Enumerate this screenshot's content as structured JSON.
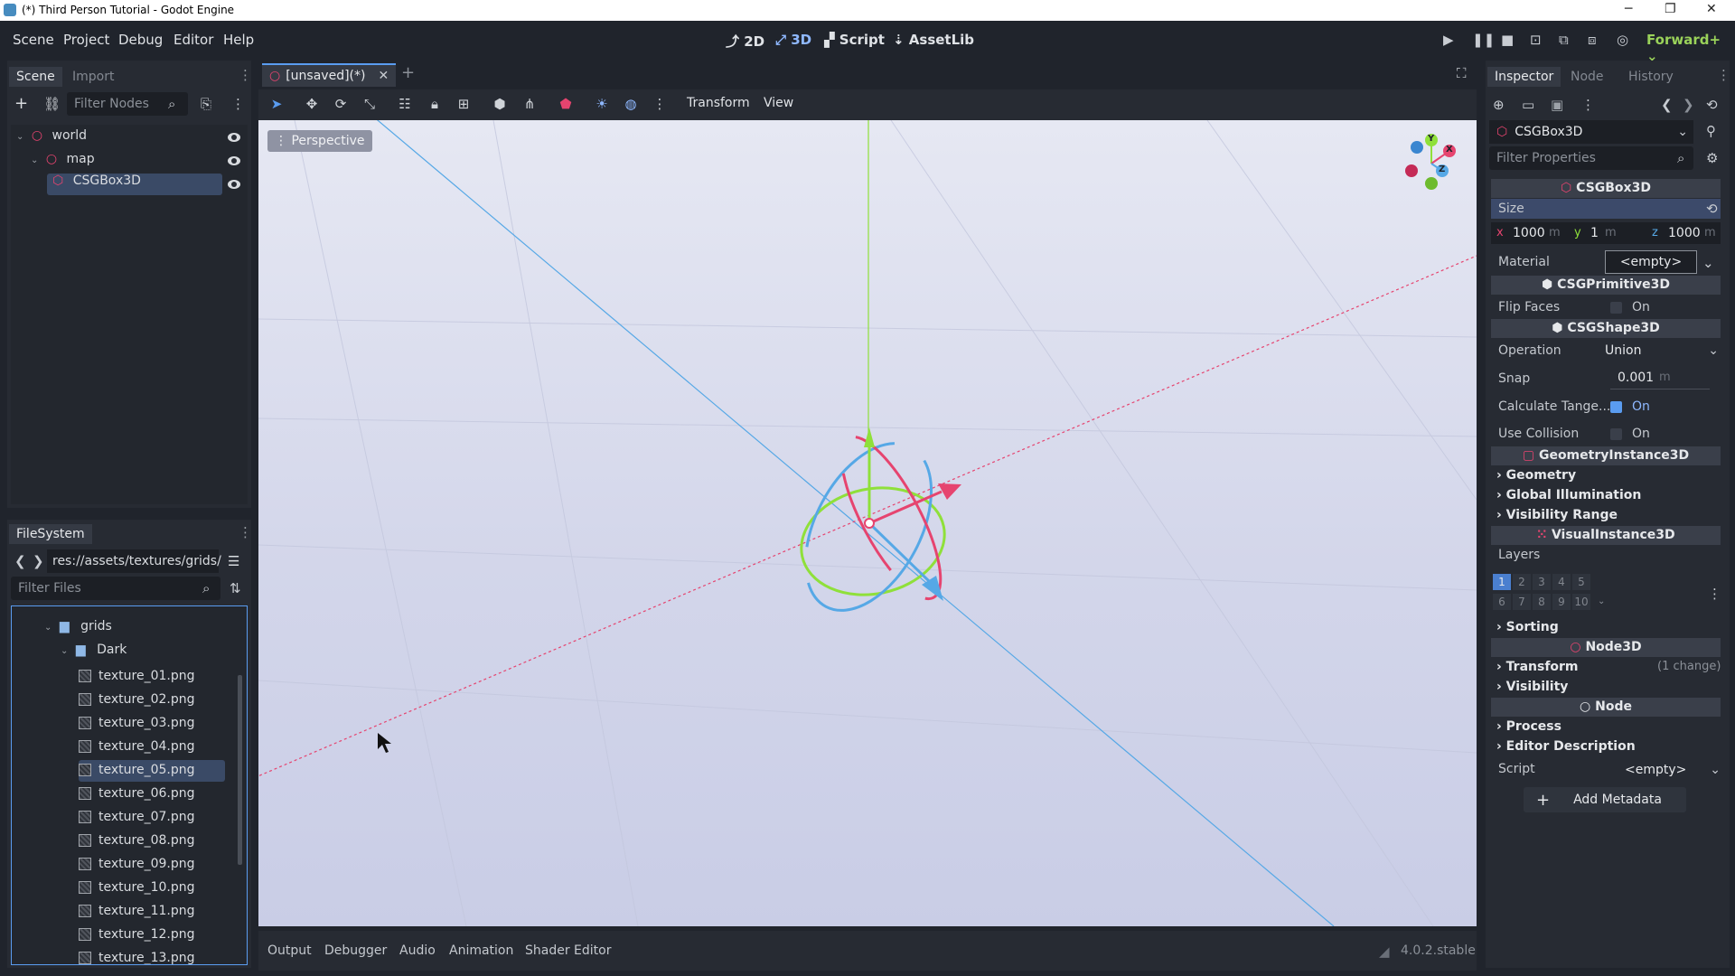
{
  "window": {
    "title": "(*) Third Person Tutorial - Godot Engine",
    "controls": [
      "─",
      "❐",
      "✕"
    ]
  },
  "menubar": {
    "menus": [
      "Scene",
      "Project",
      "Debug",
      "Editor",
      "Help"
    ],
    "workspaces": [
      "2D",
      "3D",
      "Script",
      "AssetLib"
    ],
    "active_workspace": "3D",
    "renderer": "Forward+"
  },
  "scene_dock": {
    "tabs": [
      "Scene",
      "Import"
    ],
    "filter_placeholder": "Filter Nodes",
    "nodes": [
      "world",
      "map",
      "CSGBox3D"
    ],
    "selected": "CSGBox3D"
  },
  "filesystem": {
    "tab": "FileSystem",
    "path": "res://assets/textures/grids/",
    "filter_placeholder": "Filter Files",
    "folders": [
      "grids",
      "Dark"
    ],
    "files": [
      "texture_01.png",
      "texture_02.png",
      "texture_03.png",
      "texture_04.png",
      "texture_05.png",
      "texture_06.png",
      "texture_07.png",
      "texture_08.png",
      "texture_09.png",
      "texture_10.png",
      "texture_11.png",
      "texture_12.png",
      "texture_13.png"
    ],
    "selected_file": "texture_05.png"
  },
  "editor": {
    "tab_label": "[unsaved](*)",
    "menus": [
      "Transform",
      "View"
    ],
    "perspective_label": "Perspective",
    "gizmo_axes": [
      "Y",
      "X",
      "Z"
    ]
  },
  "bottom_panel": {
    "tabs": [
      "Output",
      "Debugger",
      "Audio",
      "Animation",
      "Shader Editor"
    ],
    "version": "4.0.2.stable"
  },
  "inspector": {
    "tabs": [
      "Inspector",
      "Node",
      "History"
    ],
    "object_name": "CSGBox3D",
    "filter_placeholder": "Filter Properties",
    "sections": {
      "csgbox": "CSGBox3D",
      "csgprimitive": "CSGPrimitive3D",
      "csgshape": "CSGShape3D",
      "geometry_instance": "GeometryInstance3D",
      "visual_instance": "VisualInstance3D",
      "node3d": "Node3D",
      "node": "Node"
    },
    "size": {
      "label": "Size",
      "x_label": "x",
      "x": "1000",
      "y_label": "y",
      "y": "1",
      "z_label": "z",
      "z": "1000",
      "unit": "m"
    },
    "material": {
      "label": "Material",
      "value": "<empty>"
    },
    "flip_faces": {
      "label": "Flip Faces",
      "value": "On",
      "checked": false
    },
    "operation": {
      "label": "Operation",
      "value": "Union"
    },
    "snap": {
      "label": "Snap",
      "value": "0.001",
      "unit": "m"
    },
    "calculate_tangents": {
      "label": "Calculate Tange...",
      "value": "On",
      "checked": true
    },
    "use_collision": {
      "label": "Use Collision",
      "value": "On",
      "checked": false
    },
    "geometry_groups": [
      "Geometry",
      "Global Illumination",
      "Visibility Range"
    ],
    "layers": {
      "label": "Layers",
      "row1": [
        "1",
        "2",
        "3",
        "4",
        "5"
      ],
      "row2": [
        "6",
        "7",
        "8",
        "9",
        "10"
      ],
      "active": "1"
    },
    "sorting": "Sorting",
    "transform": {
      "label": "Transform",
      "changes": "(1 change)"
    },
    "visibility": "Visibility",
    "process": "Process",
    "editor_description": "Editor Description",
    "script": {
      "label": "Script",
      "value": "<empty>"
    },
    "add_metadata": "Add Metadata"
  },
  "colors": {
    "accent": "#5a9cf0",
    "axis_x": "#e6446f",
    "axis_y": "#8fe03a",
    "axis_z": "#56a8e6",
    "renderer": "#9ad25a"
  }
}
